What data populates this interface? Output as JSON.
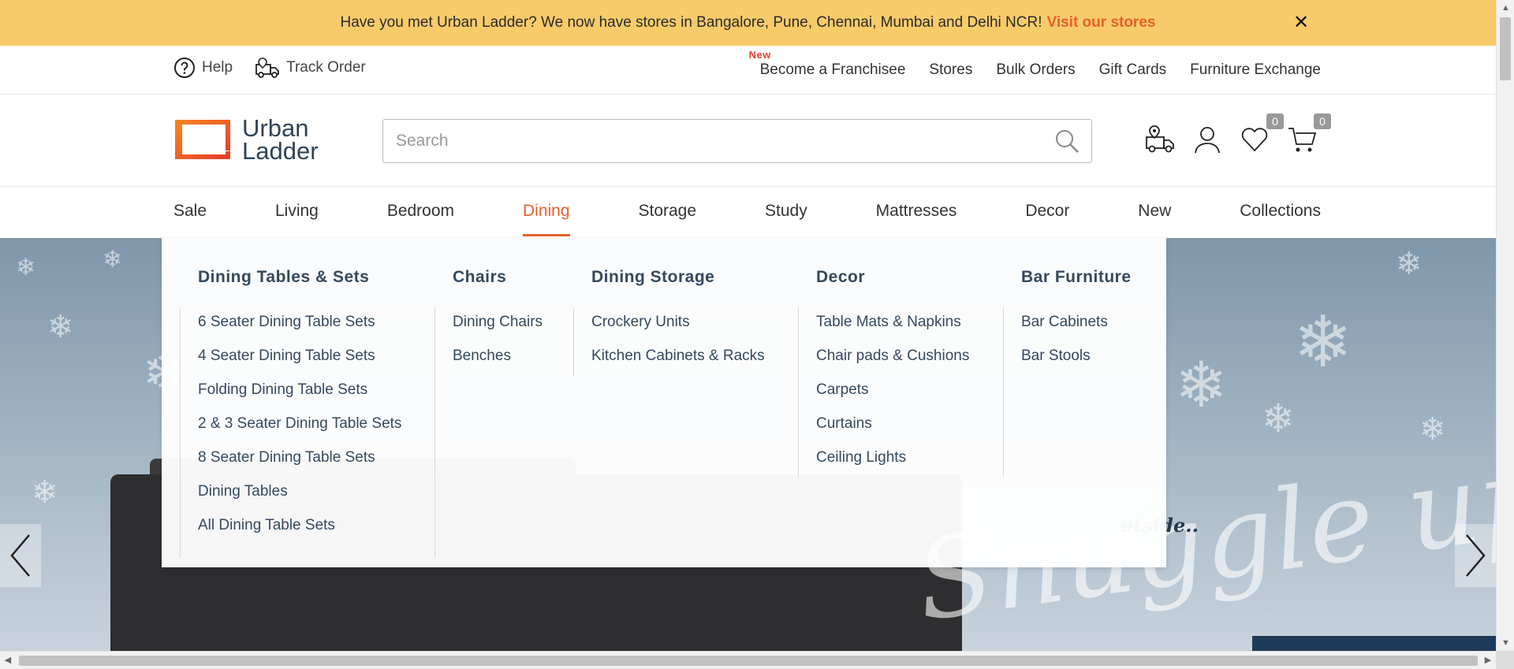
{
  "promo": {
    "message": "Have you met Urban Ladder? We now have stores in Bangalore, Pune, Chennai, Mumbai and Delhi NCR!",
    "link_label": "Visit our stores",
    "close_glyph": "✕"
  },
  "utility": {
    "help_label": "Help",
    "track_label": "Track Order",
    "new_badge": "New",
    "links": [
      "Become a Franchisee",
      "Stores",
      "Bulk Orders",
      "Gift Cards",
      "Furniture Exchange"
    ]
  },
  "header": {
    "logo_line1": "Urban",
    "logo_line2": "Ladder",
    "search_placeholder": "Search",
    "wishlist_count": "0",
    "cart_count": "0"
  },
  "nav": {
    "items": [
      "Sale",
      "Living",
      "Bedroom",
      "Dining",
      "Storage",
      "Study",
      "Mattresses",
      "Decor",
      "New",
      "Collections"
    ],
    "active": "Dining"
  },
  "mega_menu": {
    "columns": [
      {
        "heading": "Dining Tables & Sets",
        "items": [
          "6 Seater Dining Table Sets",
          "4 Seater Dining Table Sets",
          "Folding Dining Table Sets",
          "2 & 3 Seater Dining Table Sets",
          "8 Seater Dining Table Sets",
          "Dining Tables",
          "All Dining Table Sets"
        ]
      },
      {
        "heading": "Chairs",
        "items": [
          "Dining Chairs",
          "Benches"
        ]
      },
      {
        "heading": "Dining Storage",
        "items": [
          "Crockery Units",
          "Kitchen Cabinets & Racks"
        ]
      },
      {
        "heading": "Decor",
        "items": [
          "Table Mats & Napkins",
          "Chair pads & Cushions",
          "Carpets",
          "Curtains",
          "Ceiling Lights"
        ]
      },
      {
        "heading": "Bar Furniture",
        "items": [
          "Bar Cabinets",
          "Bar Stools"
        ]
      }
    ]
  },
  "hero": {
    "tagline": "utside..",
    "script_text": "Snuggle up"
  },
  "colors": {
    "accent": "#e8602c",
    "promo_bg": "#f8cb6a",
    "text_dark": "#34495e"
  }
}
